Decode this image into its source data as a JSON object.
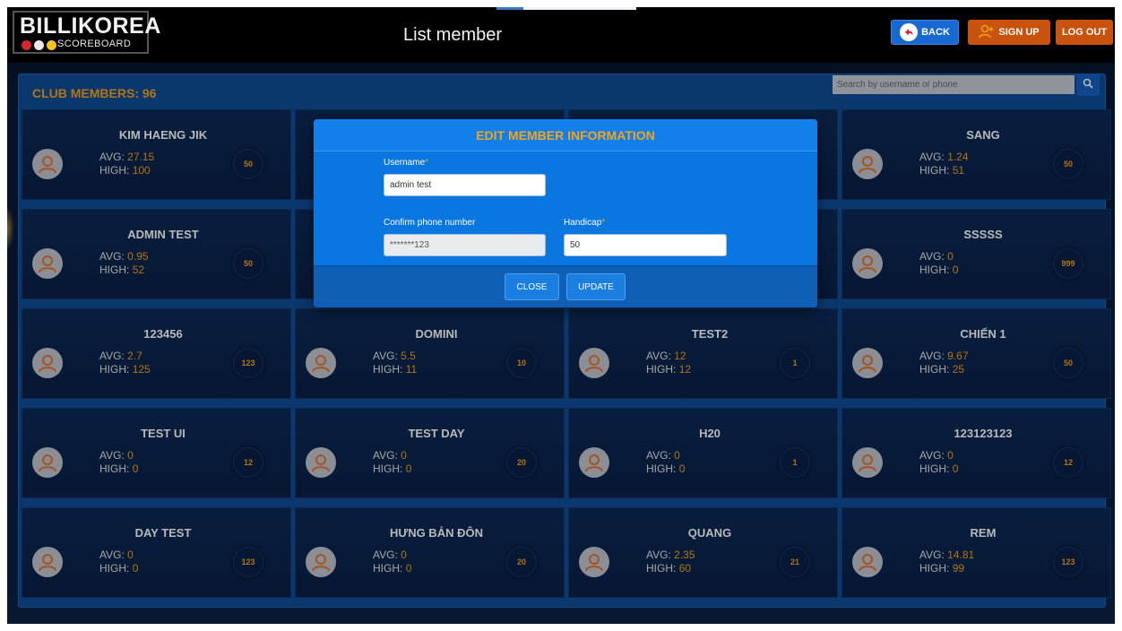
{
  "header": {
    "logo_name": "BILLIKOREA",
    "logo_sub": "SCOREBOARD",
    "logo_dot_colors": [
      "#d8262e",
      "#e8e8e8",
      "#f2c318"
    ],
    "page_title": "List member",
    "back_label": "BACK",
    "signup_label": "SIGN UP",
    "logout_label": "LOG OUT"
  },
  "panel": {
    "title": "CLUB MEMBERS: 96",
    "search_placeholder": "Search by username or phone"
  },
  "labels": {
    "avg": "AVG:",
    "high": "HIGH:"
  },
  "members": [
    {
      "name": "KIM HAENG JIK",
      "avg": "27.15",
      "high": "100",
      "handicap": "50"
    },
    {
      "name": "",
      "avg": "",
      "high": "",
      "handicap": ""
    },
    {
      "name": "",
      "avg": "",
      "high": "",
      "handicap": ""
    },
    {
      "name": "SANG",
      "avg": "1.24",
      "high": "51",
      "handicap": "50"
    },
    {
      "name": "ADMIN TEST",
      "avg": "0.95",
      "high": "52",
      "handicap": "50"
    },
    {
      "name": "",
      "avg": "",
      "high": "",
      "handicap": ""
    },
    {
      "name": "",
      "avg": "",
      "high": "",
      "handicap": ""
    },
    {
      "name": "SSSSS",
      "avg": "0",
      "high": "0",
      "handicap": "999"
    },
    {
      "name": "123456",
      "avg": "2.7",
      "high": "125",
      "handicap": "123"
    },
    {
      "name": "DOMINI",
      "avg": "5.5",
      "high": "11",
      "handicap": "10"
    },
    {
      "name": "TEST2",
      "avg": "12",
      "high": "12",
      "handicap": "1"
    },
    {
      "name": "CHIẾN 1",
      "avg": "9.67",
      "high": "25",
      "handicap": "50"
    },
    {
      "name": "TEST UI",
      "avg": "0",
      "high": "0",
      "handicap": "12"
    },
    {
      "name": "TEST DAY",
      "avg": "0",
      "high": "0",
      "handicap": "20"
    },
    {
      "name": "H20",
      "avg": "0",
      "high": "0",
      "handicap": "1"
    },
    {
      "name": "123123123",
      "avg": "0",
      "high": "0",
      "handicap": "12"
    },
    {
      "name": "DAY TEST",
      "avg": "0",
      "high": "0",
      "handicap": "123"
    },
    {
      "name": "HƯNG BẢN ĐÔN",
      "avg": "0",
      "high": "0",
      "handicap": "20"
    },
    {
      "name": "QUANG",
      "avg": "2.35",
      "high": "60",
      "handicap": "21"
    },
    {
      "name": "REM",
      "avg": "14.81",
      "high": "99",
      "handicap": "123"
    }
  ],
  "modal": {
    "title": "EDIT MEMBER INFORMATION",
    "username_label": "Username",
    "username_value": "admin test",
    "phone_label": "Confirm phone number",
    "phone_value": "*******123",
    "handicap_label": "Handicap",
    "handicap_value": "50",
    "required_mark": "*",
    "close_label": "CLOSE",
    "update_label": "UPDATE"
  },
  "colors": {
    "accent_orange": "#f5a31a",
    "panel_blue": "#0f4d99",
    "modal_blue": "#0a76df",
    "button_orange": "#c8520e",
    "button_blue": "#1669d1"
  }
}
